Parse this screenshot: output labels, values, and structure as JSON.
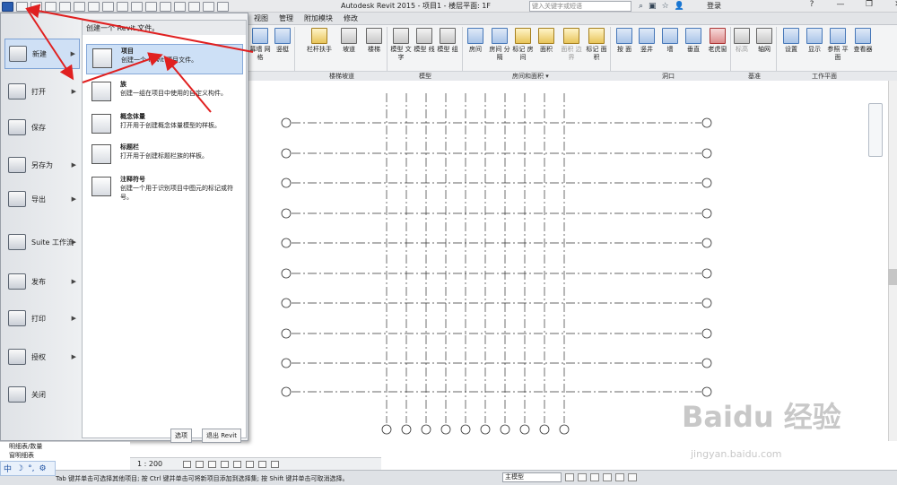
{
  "window": {
    "title": "Autodesk Revit 2015 -    项目1 - 楼层平面: 1F",
    "search_placeholder": "键入关键字或短语",
    "login": "登录",
    "help": "?"
  },
  "tabs": [
    "视图",
    "管理",
    "附加模块",
    "修改"
  ],
  "ribbon": {
    "buttons": [
      {
        "label": "幕墙 网格",
        "icon": "curtain-grid-icon"
      },
      {
        "label": "竖梃",
        "icon": "mullion-icon"
      },
      {
        "label": "栏杆扶手",
        "icon": "railing-icon"
      },
      {
        "label": "坡道",
        "icon": "ramp-icon"
      },
      {
        "label": "楼梯",
        "icon": "stair-icon"
      },
      {
        "label": "模型 文字",
        "icon": "model-text-icon"
      },
      {
        "label": "模型 线",
        "icon": "model-line-icon"
      },
      {
        "label": "模型 组",
        "icon": "model-group-icon"
      },
      {
        "label": "房间",
        "icon": "room-icon"
      },
      {
        "label": "房间 分隔",
        "icon": "room-separator-icon"
      },
      {
        "label": "标记 房间",
        "icon": "tag-room-icon"
      },
      {
        "label": "面积",
        "icon": "area-icon"
      },
      {
        "label": "面积 边界",
        "icon": "area-boundary-icon"
      },
      {
        "label": "标记 面积",
        "icon": "tag-area-icon"
      },
      {
        "label": "按 面",
        "icon": "by-face-icon"
      },
      {
        "label": "竖井",
        "icon": "shaft-icon"
      },
      {
        "label": "墙",
        "icon": "wall-opening-icon"
      },
      {
        "label": "垂直",
        "icon": "vertical-opening-icon"
      },
      {
        "label": "老虎窗",
        "icon": "dormer-icon"
      },
      {
        "label": "标高",
        "icon": "level-icon"
      },
      {
        "label": "轴网",
        "icon": "grid-icon"
      },
      {
        "label": "设置",
        "icon": "set-icon"
      },
      {
        "label": "显示",
        "icon": "show-icon"
      },
      {
        "label": "参照 平面",
        "icon": "ref-plane-icon"
      },
      {
        "label": "查看器",
        "icon": "viewer-icon"
      }
    ],
    "panels": [
      "楼梯坡道",
      "模型",
      "房间和面积 ▾",
      "洞口",
      "基准",
      "工作平面"
    ]
  },
  "app_menu": {
    "items": [
      "新建",
      "打开",
      "保存",
      "另存为",
      "导出",
      "Suite 工作流",
      "发布",
      "打印",
      "授权",
      "关闭"
    ],
    "submenu_title": "创建一个 Revit 文件。",
    "submenu": [
      {
        "title": "项目",
        "desc": "创建一个 Revit 项目文件。"
      },
      {
        "title": "族",
        "desc": "创建一组在项目中使用的自定义构件。"
      },
      {
        "title": "概念体量",
        "desc": "打开用于创建概念体量模型的样板。"
      },
      {
        "title": "标题栏",
        "desc": "打开用于创建标题栏族的样板。"
      },
      {
        "title": "注释符号",
        "desc": "创建一个用于识别项目中图元的标记或符号。"
      }
    ],
    "options_label": "选项",
    "exit_label": "退出 Revit"
  },
  "browser": [
    "明细表/数量",
    "窗明细表"
  ],
  "view": {
    "scale": "1 : 200"
  },
  "status_bar": {
    "text": "Tab 键并单击可选择其他项目; 按 Ctrl 键并单击可将新项目添加到选择集; 按 Shift 键并单击可取消选择。",
    "model": "主模型"
  },
  "ime": [
    "中",
    "☽",
    "°,",
    "⚙"
  ],
  "watermark": {
    "logo": "Baidu 经验",
    "url": "jingyan.baidu.com"
  }
}
